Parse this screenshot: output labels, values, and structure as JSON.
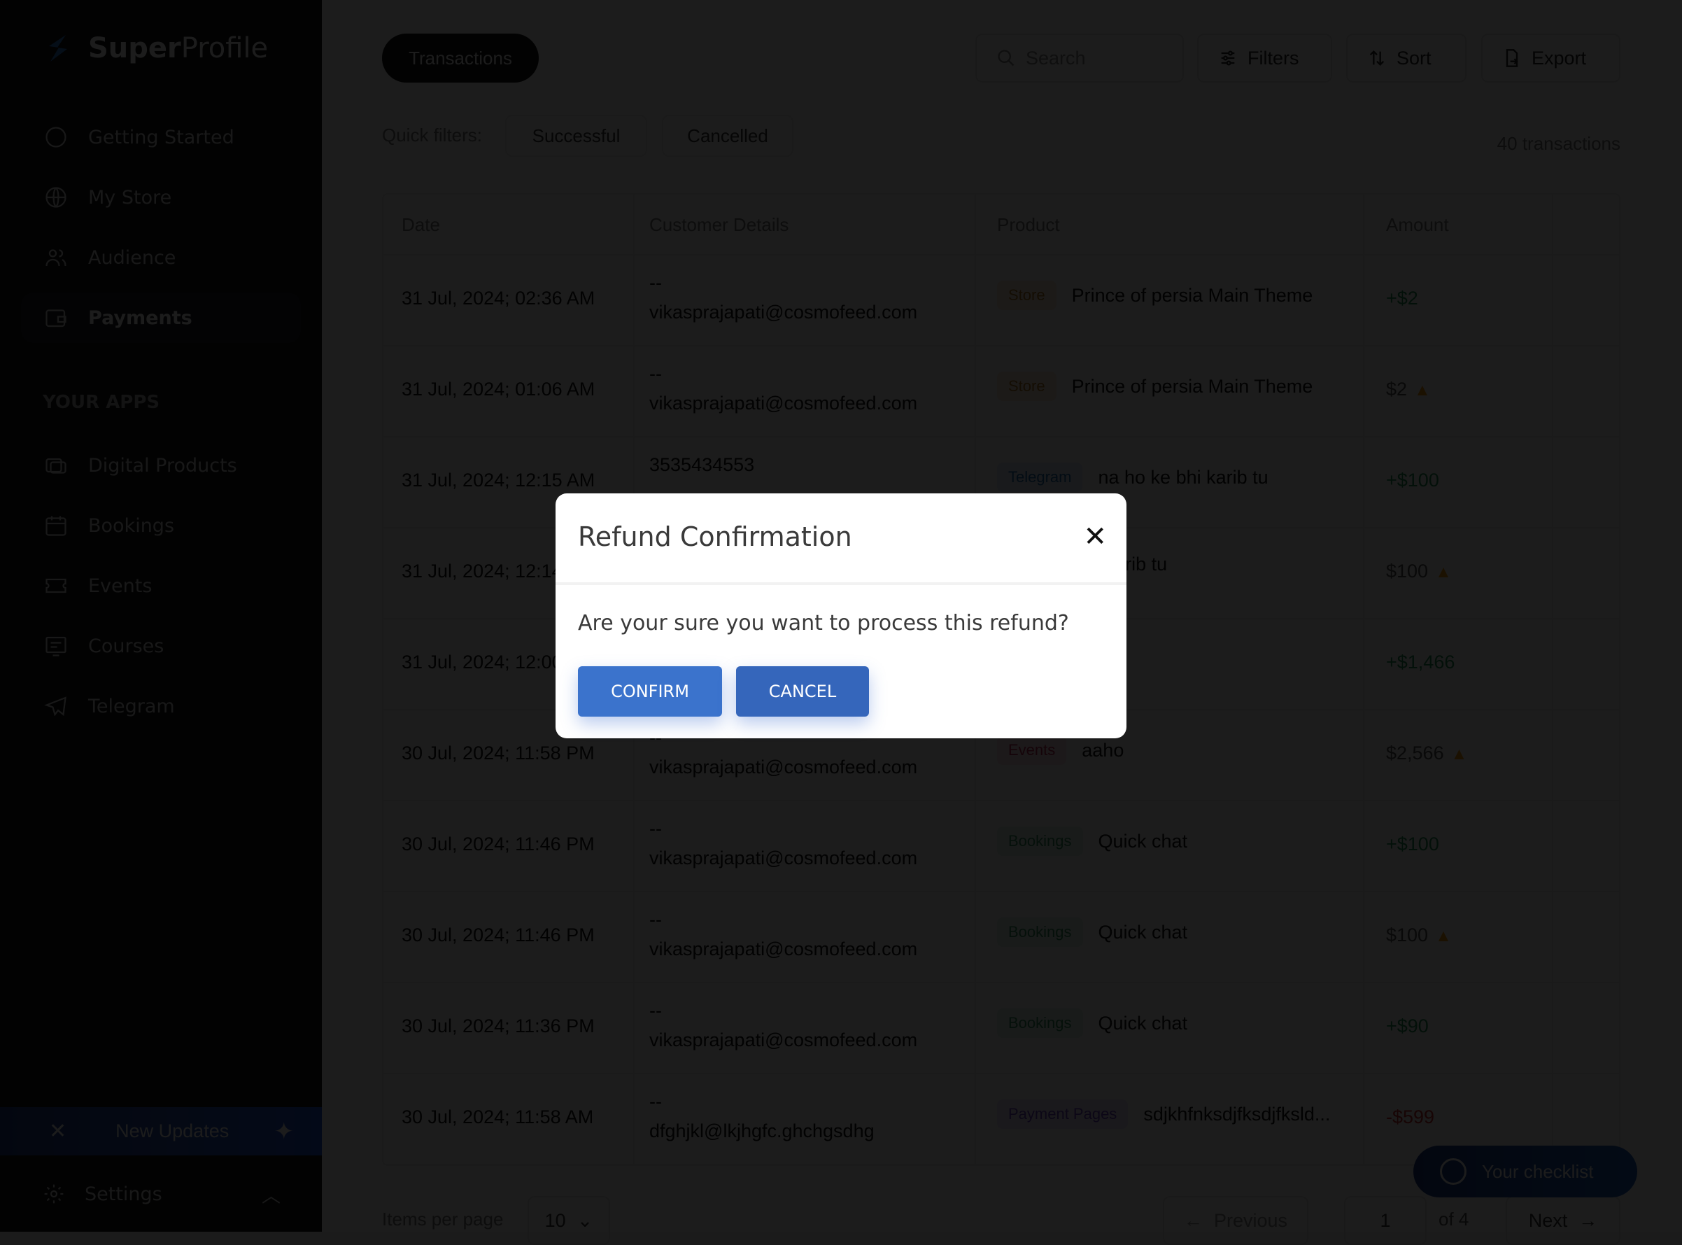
{
  "sidebar": {
    "brand_bold": "Super",
    "brand_light": "Profile",
    "nav": [
      {
        "label": "Getting Started",
        "icon": "circle-icon"
      },
      {
        "label": "My Store",
        "icon": "globe-icon"
      },
      {
        "label": "Audience",
        "icon": "users-icon"
      },
      {
        "label": "Payments",
        "icon": "wallet-icon",
        "active": true
      }
    ],
    "apps_label": "YOUR APPS",
    "apps": [
      {
        "label": "Digital Products",
        "icon": "digital-products-icon"
      },
      {
        "label": "Bookings",
        "icon": "calendar-icon"
      },
      {
        "label": "Events",
        "icon": "ticket-icon"
      },
      {
        "label": "Courses",
        "icon": "courses-icon"
      },
      {
        "label": "Telegram",
        "icon": "telegram-icon"
      }
    ],
    "updates_label": "New Updates",
    "settings_label": "Settings"
  },
  "header": {
    "tab": "Transactions",
    "search_placeholder": "Search",
    "filters": "Filters",
    "sort": "Sort",
    "export": "Export"
  },
  "quick_filters": {
    "label": "Quick filters:",
    "chips": [
      "Successful",
      "Cancelled"
    ]
  },
  "count": "40 transactions",
  "table": {
    "columns": [
      "Date",
      "Customer Details",
      "Product",
      "Amount"
    ],
    "rows": [
      {
        "date": "31 Jul, 2024; 02:36 AM",
        "line1": "--",
        "line2": "vikasprajapati@cosmofeed.com",
        "badge": "Store",
        "product": "Prince of persia Main Theme",
        "amount": "+$2",
        "status": "success"
      },
      {
        "date": "31 Jul, 2024; 01:06 AM",
        "line1": "--",
        "line2": "vikasprajapati@cosmofeed.com",
        "badge": "Store",
        "product": "Prince of persia Main Theme",
        "amount": "$2",
        "status": "warning"
      },
      {
        "date": "31 Jul, 2024; 12:15 AM",
        "line1": "3535434553",
        "line2": "",
        "badge": "Telegram",
        "product": "na ho ke bhi karib tu",
        "amount": "+$100",
        "status": "success"
      },
      {
        "date": "31 Jul, 2024; 12:14 AM",
        "line1": "",
        "line2": "",
        "badge": "",
        "product": "na ho ke bhi karib tu",
        "amount": "$100",
        "status": "warning"
      },
      {
        "date": "31 Jul, 2024; 12:00 AM",
        "line1": "",
        "line2": "",
        "badge": "",
        "product": "",
        "amount": "+$1,466",
        "status": "success"
      },
      {
        "date": "30 Jul, 2024; 11:58 PM",
        "line1": "--",
        "line2": "vikasprajapati@cosmofeed.com",
        "badge": "Events",
        "product": "aaho",
        "amount": "$2,566",
        "status": "warning"
      },
      {
        "date": "30 Jul, 2024; 11:46 PM",
        "line1": "--",
        "line2": "vikasprajapati@cosmofeed.com",
        "badge": "Bookings",
        "product": "Quick chat",
        "amount": "+$100",
        "status": "success"
      },
      {
        "date": "30 Jul, 2024; 11:46 PM",
        "line1": "--",
        "line2": "vikasprajapati@cosmofeed.com",
        "badge": "Bookings",
        "product": "Quick chat",
        "amount": "$100",
        "status": "warning"
      },
      {
        "date": "30 Jul, 2024; 11:36 PM",
        "line1": "--",
        "line2": "vikasprajapati@cosmofeed.com",
        "badge": "Bookings",
        "product": "Quick chat",
        "amount": "+$90",
        "status": "success"
      },
      {
        "date": "30 Jul, 2024; 11:58 AM",
        "line1": "--",
        "line2": "dfghjkl@lkjhgfc.ghchgsdhg",
        "badge": "Payment Pages",
        "product": "sdjkhfnksdjfksdjfksld...",
        "amount": "-$599",
        "status": "refund"
      }
    ]
  },
  "badge_colors": {
    "Store": {
      "bg": "#fdf0dc",
      "fg": "#b7791f"
    },
    "Telegram": {
      "bg": "#e0eefb",
      "fg": "#1f6fb5"
    },
    "Events": {
      "bg": "#fde4ea",
      "fg": "#c0264f"
    },
    "Bookings": {
      "bg": "#e2f5ec",
      "fg": "#2f8f5f"
    },
    "Payment Pages": {
      "bg": "#eee6fb",
      "fg": "#6b3fc9"
    }
  },
  "amount_colors": {
    "success": "#1f9254",
    "warning": "#555555",
    "refund": "#d32f2f"
  },
  "pagination": {
    "items_label": "Items per page",
    "per_page": "10",
    "previous": "Previous",
    "page": "1",
    "of": "of 4",
    "next": "Next"
  },
  "checklist": "Your checklist",
  "modal": {
    "title": "Refund Confirmation",
    "message": "Are your sure you want to process this refund?",
    "confirm": "CONFIRM",
    "cancel": "CANCEL"
  }
}
